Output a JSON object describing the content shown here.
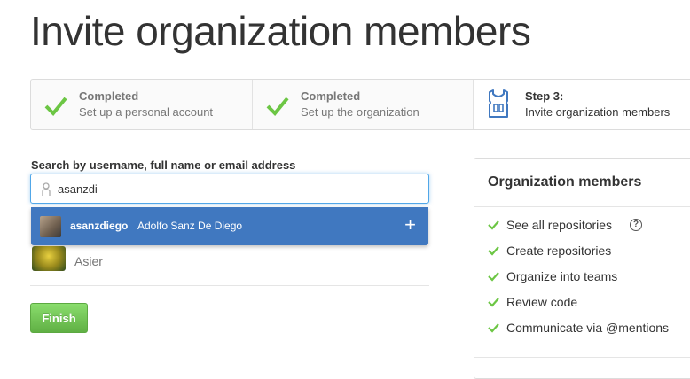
{
  "page": {
    "title": "Invite organization members"
  },
  "steps": [
    {
      "status": "Completed",
      "description": "Set up a personal account",
      "icon": "check-icon"
    },
    {
      "status": "Completed",
      "description": "Set up the organization",
      "icon": "check-icon"
    },
    {
      "status": "Step 3:",
      "description": "Invite organization members",
      "icon": "jersey-icon"
    }
  ],
  "search": {
    "label": "Search by username, full name or email address",
    "value": "asanzdi"
  },
  "suggestion": {
    "username": "asanzdiego",
    "full_name": "Adolfo Sanz De Diego",
    "add_icon": "+"
  },
  "members": [
    {
      "name": "Asier"
    }
  ],
  "finish_label": "Finish",
  "panel": {
    "title": "Organization members",
    "items": [
      {
        "label": "See all repositories",
        "help": "?"
      },
      {
        "label": "Create repositories"
      },
      {
        "label": "Organize into teams"
      },
      {
        "label": "Review code"
      },
      {
        "label": "Communicate via @mentions"
      }
    ]
  },
  "colors": {
    "accent_blue": "#4078c0",
    "success_green": "#6cc644",
    "focus_border": "#51a7e8"
  }
}
